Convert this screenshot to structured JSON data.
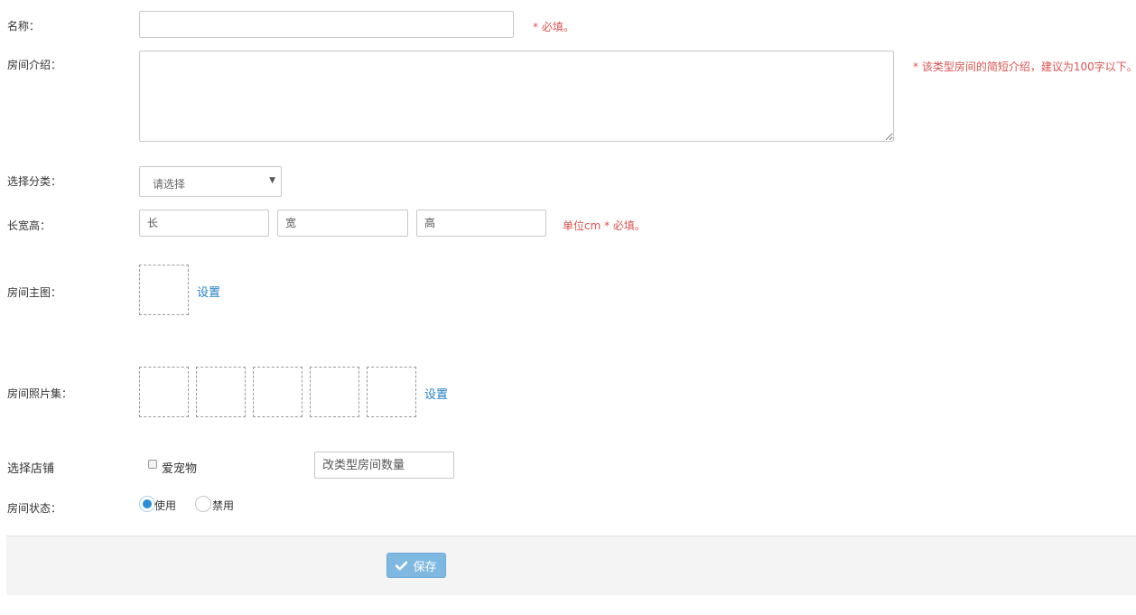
{
  "form": {
    "name": {
      "label": "名称：",
      "value": "",
      "hint": "* 必填。"
    },
    "intro": {
      "label": "房间介绍：",
      "value": "",
      "hint": "* 该类型房间的简短介绍，建议为100字以下。"
    },
    "category": {
      "label": "选择分类：",
      "selected": "请选择"
    },
    "dimensions": {
      "label": "长宽高：",
      "length_placeholder": "长",
      "width_placeholder": "宽",
      "height_placeholder": "高",
      "hint": "单位cm * 必填。"
    },
    "main_image": {
      "label": "房间主图：",
      "set_link": "设置"
    },
    "photo_set": {
      "label": "房间照片集：",
      "set_link": "设置"
    },
    "store": {
      "label": "选择店铺",
      "checkbox_label": "爱宠物",
      "checked": false,
      "count_placeholder": "改类型房间数量"
    },
    "status": {
      "label": "房间状态：",
      "options": [
        "使用",
        "禁用"
      ],
      "selected": "使用"
    }
  },
  "footer": {
    "save_label": "保存"
  },
  "colors": {
    "hint": "#d9534f",
    "link": "#1f7fc4",
    "save_button": "#7fb9e2",
    "radio_selected": "#2b8ed6"
  },
  "icons": {
    "save": "check-icon",
    "select": "caret-down-icon"
  }
}
